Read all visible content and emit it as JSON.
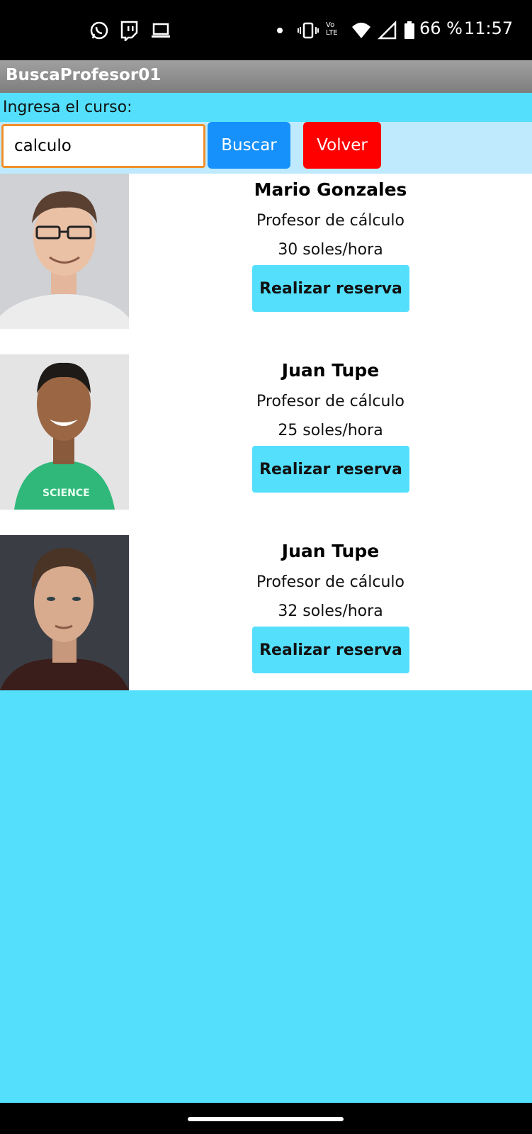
{
  "status_bar": {
    "left_icons": [
      "whatsapp-icon",
      "twitch-icon",
      "laptop-icon"
    ],
    "right_icons": [
      "dot-icon",
      "vibrate-icon",
      "volte-icon",
      "wifi-icon",
      "signal-icon",
      "battery-icon"
    ],
    "volte_label": "Vo LTE",
    "battery": "66 %",
    "time": "11:57"
  },
  "app_bar": {
    "title": "BuscaProfesor01"
  },
  "search": {
    "prompt": "Ingresa el curso:",
    "value": "calculo",
    "search_label": "Buscar",
    "back_label": "Volver",
    "colors": {
      "search": "#1691fb",
      "back": "#ff0000",
      "focus_border": "#f0902a"
    }
  },
  "results": [
    {
      "name": "Mario Gonzales",
      "role": "Profesor de cálculo",
      "price": "30 soles/hora",
      "action": "Realizar reserva"
    },
    {
      "name": "Juan Tupe",
      "role": "Profesor de cálculo",
      "price": "25 soles/hora",
      "action": "Realizar reserva"
    },
    {
      "name": "Juan Tupe",
      "role": "Profesor de cálculo",
      "price": "32 soles/hora",
      "action": "Realizar reserva"
    }
  ],
  "theme": {
    "accent": "#54dffd",
    "app_bar": "#8a8a8a"
  }
}
